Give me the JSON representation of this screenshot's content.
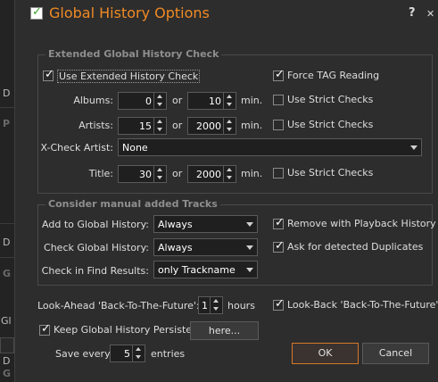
{
  "background": {
    "fragments": [
      "D",
      "P",
      "D",
      "G",
      "Gl",
      "D",
      "G"
    ]
  },
  "dialog": {
    "title": "Global History Options",
    "help_label": "?",
    "close_label": "✕"
  },
  "extended": {
    "group_title": "Extended Global History Check",
    "use_extended_label": "Use Extended History Check",
    "use_extended_checked": true,
    "force_tag_label": "Force TAG Reading",
    "force_tag_checked": true,
    "or_label": "or",
    "min_label": "min.",
    "strict_label": "Use Strict Checks",
    "albums": {
      "label": "Albums:",
      "value1": "0",
      "value2": "10",
      "strict": false
    },
    "artists": {
      "label": "Artists:",
      "value1": "15",
      "value2": "2000",
      "strict": false
    },
    "xcheck": {
      "label": "X-Check Artist:",
      "value": "None"
    },
    "title": {
      "label": "Title:",
      "value1": "30",
      "value2": "2000",
      "strict": false
    }
  },
  "manual": {
    "group_title": "Consider manual added Tracks",
    "add_label": "Add to Global History:",
    "add_value": "Always",
    "check_label": "Check Global History:",
    "check_value": "Always",
    "find_label": "Check in Find Results:",
    "find_value": "only Trackname",
    "remove_label": "Remove with Playback History",
    "remove_checked": true,
    "ask_label": "Ask for detected Duplicates",
    "ask_checked": true
  },
  "bottom": {
    "lookahead_label": "Look-Ahead 'Back-To-The-Future':",
    "lookahead_value": "1",
    "hours_label": "hours",
    "lookback_label": "Look-Back 'Back-To-The-Future'",
    "lookback_checked": true,
    "keep_label": "Keep Global History Persistent",
    "keep_checked": true,
    "here_label": "here...",
    "save_every_label": "Save every",
    "save_every_value": "5",
    "entries_label": "entries",
    "ok_label": "OK",
    "cancel_label": "Cancel"
  },
  "colors": {
    "accent": "#f08a24",
    "background": "#2d2d2d",
    "ok_border": "#d4782a"
  }
}
